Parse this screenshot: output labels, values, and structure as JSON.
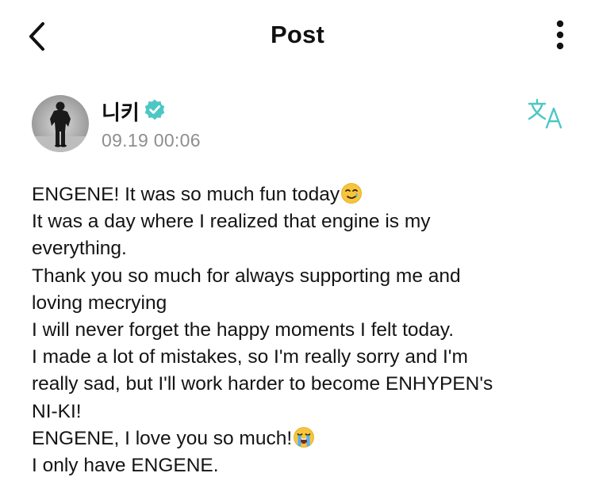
{
  "header": {
    "title": "Post",
    "back_icon": "chevron-left-icon",
    "more_icon": "vertical-ellipsis-icon"
  },
  "author": {
    "name": "니키",
    "verified_icon": "verified-badge-icon",
    "timestamp": "09.19 00:06",
    "avatar": "avatar-photo"
  },
  "translate": {
    "icon": "translate-icon"
  },
  "post": {
    "lines": [
      "ENGENE! It was so much fun today",
      "It was a day where I realized that engine is my",
      "everything.",
      "Thank you so much for always supporting me and",
      "loving mecrying",
      "I will never forget the happy moments I felt today.",
      "I made a lot of mistakes, so I'm really sorry and I'm",
      "really sad, but I'll work harder to become ENHYPEN's",
      "NI-KI!",
      "ENGENE, I love you so much!",
      "I only have ENGENE."
    ],
    "emojis": {
      "line1": "smiling-face-with-tear-emoji",
      "line10": "loudly-crying-face-emoji"
    }
  },
  "colors": {
    "accent_teal": "#4cc7c5",
    "timestamp_gray": "#8e8e8e",
    "text": "#141414"
  }
}
